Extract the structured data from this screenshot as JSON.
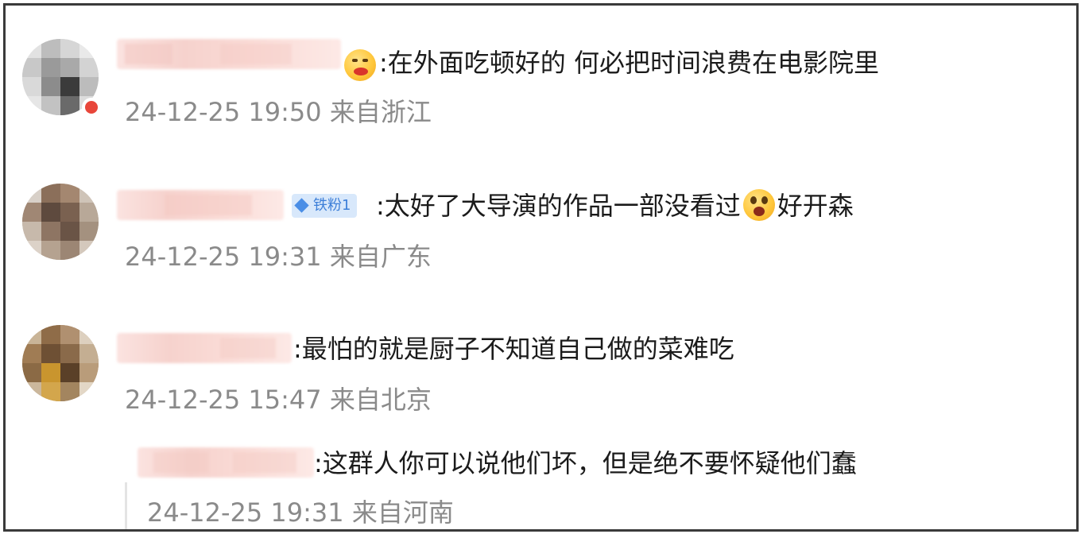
{
  "comments": [
    {
      "text": ":在外面吃顿好的 何必把时间浪费在电影院里",
      "timestamp": "24-12-25 19:50",
      "location": "来自浙江",
      "emoji": "drooling-face-icon"
    },
    {
      "badge": "铁粉1",
      "text": ":太好了大导演的作品一部没看过",
      "emoji": "surprised-face-icon",
      "text_after": "好开森",
      "timestamp": "24-12-25 19:31",
      "location": "来自广东"
    },
    {
      "text": ":最怕的就是厨子不知道自己做的菜难吃",
      "timestamp": "24-12-25 15:47",
      "location": "来自北京"
    },
    {
      "text": ":这群人你可以说他们坏，但是绝不要怀疑他们蠢",
      "timestamp": "24-12-25 19:31",
      "location": "来自河南"
    }
  ],
  "colors": {
    "text": "#1b1b1b",
    "meta": "#8a8a8a",
    "badge_bg": "#d8e8fb",
    "badge_fg": "#3d7fd8",
    "frame_border": "#3a3a3a"
  }
}
